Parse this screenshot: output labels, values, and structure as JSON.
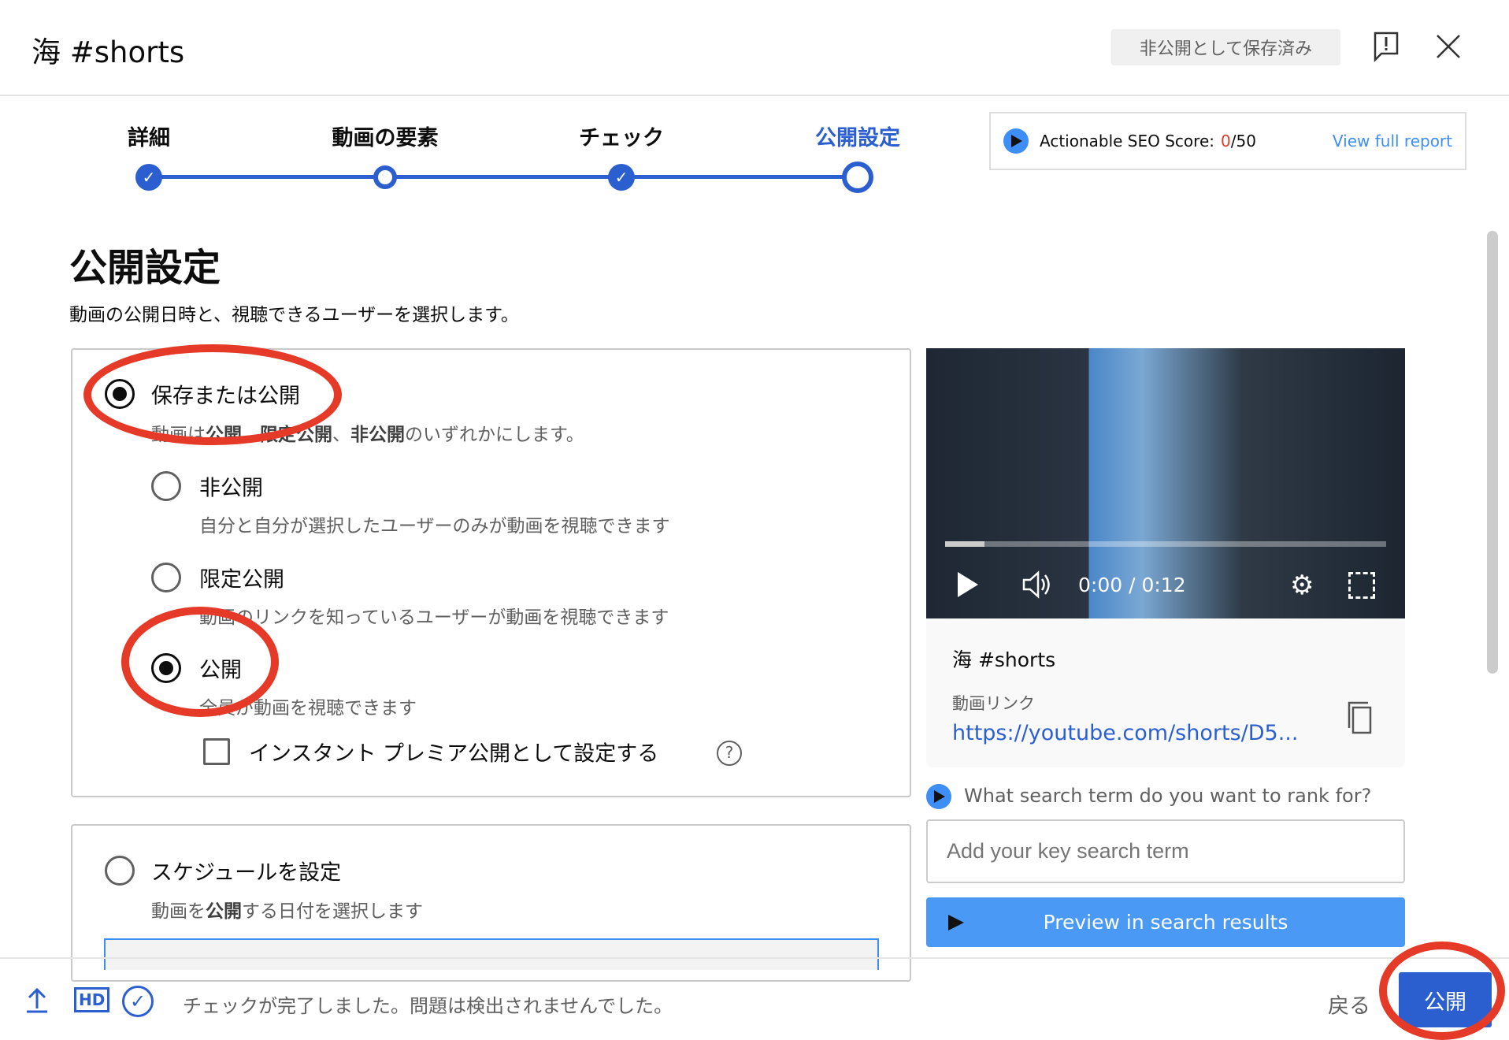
{
  "header": {
    "title": "海 #shorts",
    "saved_badge": "非公開として保存済み",
    "feedback_icon": "feedback-icon",
    "close_icon": "close-icon"
  },
  "stepper": {
    "steps": [
      {
        "label": "詳細",
        "state": "done"
      },
      {
        "label": "動画の要素",
        "state": "visited"
      },
      {
        "label": "チェック",
        "state": "done"
      },
      {
        "label": "公開設定",
        "state": "current"
      }
    ],
    "accent": "#2b5fd0"
  },
  "seo": {
    "label": "Actionable SEO Score:",
    "score": "0",
    "total": "/50",
    "link": "View full report"
  },
  "main": {
    "title": "公開設定",
    "subtitle": "動画の公開日時と、視聴できるユーザーを選択します。",
    "save_or_publish": {
      "label": "保存または公開",
      "desc_parts": [
        "動画は",
        "公開",
        "、",
        "限定公開",
        "、",
        "非公開",
        "のいずれかにします。"
      ],
      "selected": true
    },
    "options": [
      {
        "label": "非公開",
        "desc": "自分と自分が選択したユーザーのみが動画を視聴できます",
        "selected": false
      },
      {
        "label": "限定公開",
        "desc": "動画のリンクを知っているユーザーが動画を視聴できます",
        "selected": false
      },
      {
        "label": "公開",
        "desc": "全員が動画を視聴できます",
        "selected": true
      }
    ],
    "premiere": {
      "label": "インスタント プレミア公開として設定する",
      "checked": false
    },
    "schedule": {
      "label": "スケジュールを設定",
      "desc_parts": [
        "動画を",
        "公開",
        "する日付を選択します"
      ]
    }
  },
  "video": {
    "time": "0:00 / 0:12",
    "progress": 0.09,
    "title": "海 #shorts",
    "link_label": "動画リンク",
    "link": "https://youtube.com/shorts/D5..."
  },
  "search": {
    "question": "What search term do you want to rank for?",
    "placeholder": "Add your key search term",
    "preview_button": "Preview in search results"
  },
  "footer": {
    "status": "チェックが完了しました。問題は検出されませんでした。",
    "back": "戻る",
    "publish": "公開",
    "hd": "HD"
  },
  "colors": {
    "annotation": "#e53a27",
    "link": "#2b5fd0",
    "preview_button": "#4a9af5"
  }
}
